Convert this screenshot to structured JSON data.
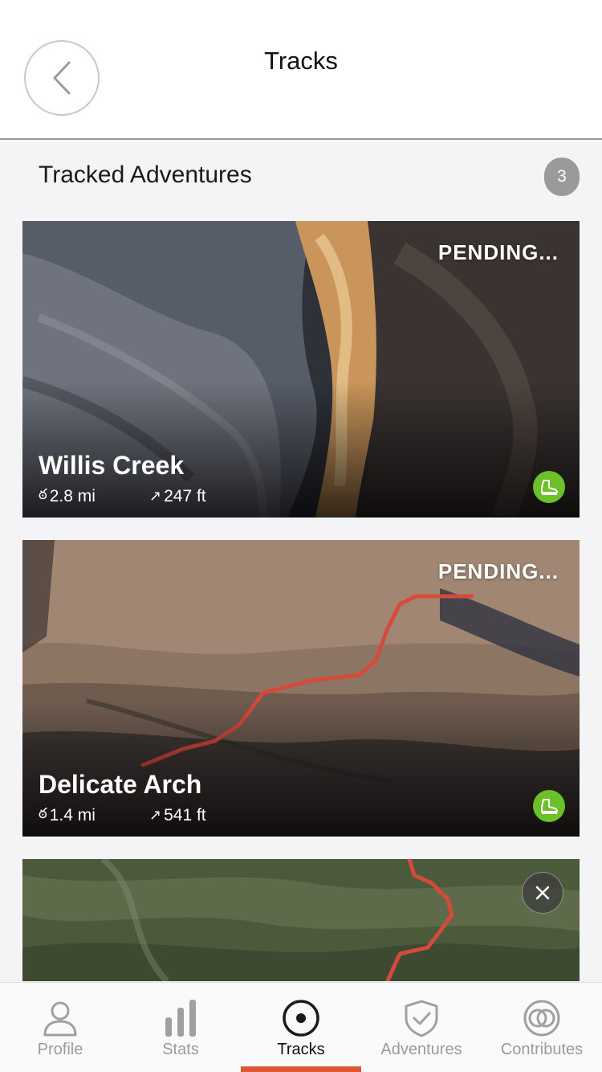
{
  "status_bar": {
    "battery_color": "#4cd964"
  },
  "header": {
    "title": "Tracks",
    "back_icon": "chevron-left-icon"
  },
  "section": {
    "title": "Tracked Adventures",
    "count": "3"
  },
  "cards": [
    {
      "status": "PENDING...",
      "title": "Willis Creek",
      "distance": "2.8 mi",
      "elevation": "247 ft",
      "activity_icon": "hiking-boot-icon"
    },
    {
      "status": "PENDING...",
      "title": "Delicate Arch",
      "distance": "1.4 mi",
      "elevation": "541 ft",
      "activity_icon": "hiking-boot-icon"
    },
    {
      "close_icon": "close-icon"
    }
  ],
  "stat_icons": {
    "distance": "ఠ",
    "elevation": "↗"
  },
  "tabs": [
    {
      "label": "Profile",
      "icon": "person-icon",
      "active": false
    },
    {
      "label": "Stats",
      "icon": "bar-chart-icon",
      "active": false
    },
    {
      "label": "Tracks",
      "icon": "record-icon",
      "active": true
    },
    {
      "label": "Adventures",
      "icon": "shield-check-icon",
      "active": false
    },
    {
      "label": "Contributes",
      "icon": "rings-icon",
      "active": false
    }
  ],
  "colors": {
    "accent": "#e05634",
    "activity_green": "#6cc02a",
    "badge_gray": "#9a9a9a"
  }
}
